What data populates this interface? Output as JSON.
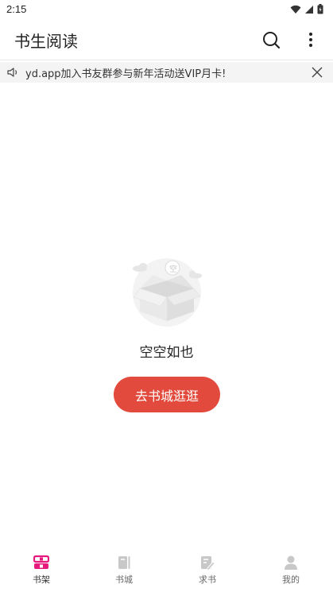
{
  "status_bar": {
    "time": "2:15"
  },
  "app_bar": {
    "title": "书生阅读"
  },
  "notice": {
    "text": "yd.app加入书友群参与新年活动送VIP月卡!"
  },
  "empty_state": {
    "badge": "空",
    "message": "空空如也",
    "button_label": "去书城逛逛"
  },
  "bottom_nav": {
    "items": [
      {
        "label": "书架",
        "icon": "bookshelf-icon",
        "active": true
      },
      {
        "label": "书城",
        "icon": "bookstore-icon",
        "active": false
      },
      {
        "label": "求书",
        "icon": "request-book-icon",
        "active": false
      },
      {
        "label": "我的",
        "icon": "profile-icon",
        "active": false
      }
    ]
  },
  "colors": {
    "accent": "#e14a3c",
    "active_nav": "#e6197d",
    "inactive_nav": "#c8c8c8",
    "notice_bg": "#f4f4f4"
  }
}
